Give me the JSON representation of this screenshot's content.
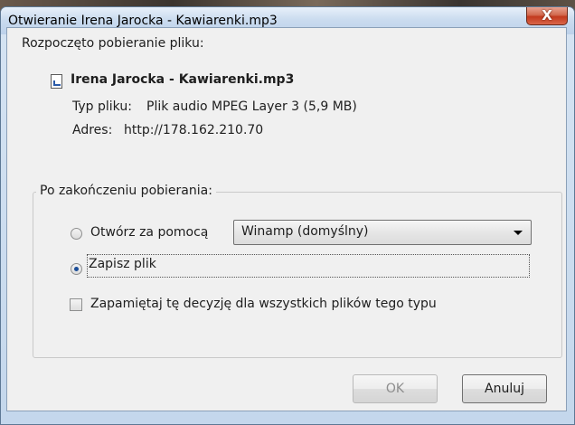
{
  "window": {
    "title": "Otwieranie Irena Jarocka - Kawiarenki.mp3",
    "close_glyph": "X"
  },
  "info": {
    "started": "Rozpoczęto pobieranie pliku:",
    "file_icon": "audio-file-icon",
    "filename": "Irena Jarocka - Kawiarenki.mp3",
    "type_label": "Typ pliku:",
    "type_value": "Plik audio MPEG Layer 3 (5,9 MB)",
    "address_label": "Adres:",
    "address_value": "http://178.162.210.70"
  },
  "options": {
    "group_title": "Po zakończeniu pobierania:",
    "open_with_label": "Otwórz za pomocą",
    "open_with_app": "Winamp (domyślny)",
    "save_label": "Zapisz plik",
    "selected": "save",
    "remember_label": "Zapamiętaj tę decyzję dla wszystkich plików tego typu",
    "remember_checked": false
  },
  "buttons": {
    "ok": "OK",
    "cancel": "Anuluj"
  }
}
